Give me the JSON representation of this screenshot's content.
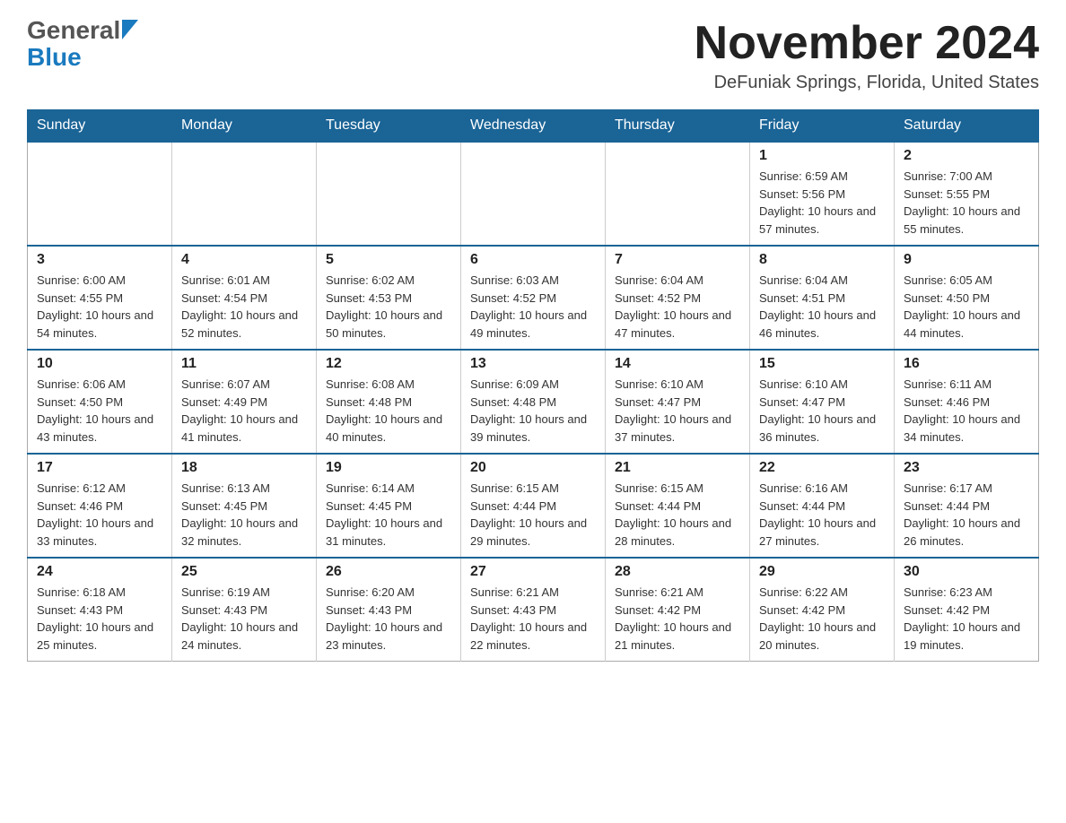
{
  "header": {
    "logo_general": "General",
    "logo_blue": "Blue",
    "month_year": "November 2024",
    "location": "DeFuniak Springs, Florida, United States"
  },
  "calendar": {
    "days_of_week": [
      "Sunday",
      "Monday",
      "Tuesday",
      "Wednesday",
      "Thursday",
      "Friday",
      "Saturday"
    ],
    "weeks": [
      [
        {
          "day": "",
          "info": ""
        },
        {
          "day": "",
          "info": ""
        },
        {
          "day": "",
          "info": ""
        },
        {
          "day": "",
          "info": ""
        },
        {
          "day": "",
          "info": ""
        },
        {
          "day": "1",
          "info": "Sunrise: 6:59 AM\nSunset: 5:56 PM\nDaylight: 10 hours and 57 minutes."
        },
        {
          "day": "2",
          "info": "Sunrise: 7:00 AM\nSunset: 5:55 PM\nDaylight: 10 hours and 55 minutes."
        }
      ],
      [
        {
          "day": "3",
          "info": "Sunrise: 6:00 AM\nSunset: 4:55 PM\nDaylight: 10 hours and 54 minutes."
        },
        {
          "day": "4",
          "info": "Sunrise: 6:01 AM\nSunset: 4:54 PM\nDaylight: 10 hours and 52 minutes."
        },
        {
          "day": "5",
          "info": "Sunrise: 6:02 AM\nSunset: 4:53 PM\nDaylight: 10 hours and 50 minutes."
        },
        {
          "day": "6",
          "info": "Sunrise: 6:03 AM\nSunset: 4:52 PM\nDaylight: 10 hours and 49 minutes."
        },
        {
          "day": "7",
          "info": "Sunrise: 6:04 AM\nSunset: 4:52 PM\nDaylight: 10 hours and 47 minutes."
        },
        {
          "day": "8",
          "info": "Sunrise: 6:04 AM\nSunset: 4:51 PM\nDaylight: 10 hours and 46 minutes."
        },
        {
          "day": "9",
          "info": "Sunrise: 6:05 AM\nSunset: 4:50 PM\nDaylight: 10 hours and 44 minutes."
        }
      ],
      [
        {
          "day": "10",
          "info": "Sunrise: 6:06 AM\nSunset: 4:50 PM\nDaylight: 10 hours and 43 minutes."
        },
        {
          "day": "11",
          "info": "Sunrise: 6:07 AM\nSunset: 4:49 PM\nDaylight: 10 hours and 41 minutes."
        },
        {
          "day": "12",
          "info": "Sunrise: 6:08 AM\nSunset: 4:48 PM\nDaylight: 10 hours and 40 minutes."
        },
        {
          "day": "13",
          "info": "Sunrise: 6:09 AM\nSunset: 4:48 PM\nDaylight: 10 hours and 39 minutes."
        },
        {
          "day": "14",
          "info": "Sunrise: 6:10 AM\nSunset: 4:47 PM\nDaylight: 10 hours and 37 minutes."
        },
        {
          "day": "15",
          "info": "Sunrise: 6:10 AM\nSunset: 4:47 PM\nDaylight: 10 hours and 36 minutes."
        },
        {
          "day": "16",
          "info": "Sunrise: 6:11 AM\nSunset: 4:46 PM\nDaylight: 10 hours and 34 minutes."
        }
      ],
      [
        {
          "day": "17",
          "info": "Sunrise: 6:12 AM\nSunset: 4:46 PM\nDaylight: 10 hours and 33 minutes."
        },
        {
          "day": "18",
          "info": "Sunrise: 6:13 AM\nSunset: 4:45 PM\nDaylight: 10 hours and 32 minutes."
        },
        {
          "day": "19",
          "info": "Sunrise: 6:14 AM\nSunset: 4:45 PM\nDaylight: 10 hours and 31 minutes."
        },
        {
          "day": "20",
          "info": "Sunrise: 6:15 AM\nSunset: 4:44 PM\nDaylight: 10 hours and 29 minutes."
        },
        {
          "day": "21",
          "info": "Sunrise: 6:15 AM\nSunset: 4:44 PM\nDaylight: 10 hours and 28 minutes."
        },
        {
          "day": "22",
          "info": "Sunrise: 6:16 AM\nSunset: 4:44 PM\nDaylight: 10 hours and 27 minutes."
        },
        {
          "day": "23",
          "info": "Sunrise: 6:17 AM\nSunset: 4:44 PM\nDaylight: 10 hours and 26 minutes."
        }
      ],
      [
        {
          "day": "24",
          "info": "Sunrise: 6:18 AM\nSunset: 4:43 PM\nDaylight: 10 hours and 25 minutes."
        },
        {
          "day": "25",
          "info": "Sunrise: 6:19 AM\nSunset: 4:43 PM\nDaylight: 10 hours and 24 minutes."
        },
        {
          "day": "26",
          "info": "Sunrise: 6:20 AM\nSunset: 4:43 PM\nDaylight: 10 hours and 23 minutes."
        },
        {
          "day": "27",
          "info": "Sunrise: 6:21 AM\nSunset: 4:43 PM\nDaylight: 10 hours and 22 minutes."
        },
        {
          "day": "28",
          "info": "Sunrise: 6:21 AM\nSunset: 4:42 PM\nDaylight: 10 hours and 21 minutes."
        },
        {
          "day": "29",
          "info": "Sunrise: 6:22 AM\nSunset: 4:42 PM\nDaylight: 10 hours and 20 minutes."
        },
        {
          "day": "30",
          "info": "Sunrise: 6:23 AM\nSunset: 4:42 PM\nDaylight: 10 hours and 19 minutes."
        }
      ]
    ]
  }
}
